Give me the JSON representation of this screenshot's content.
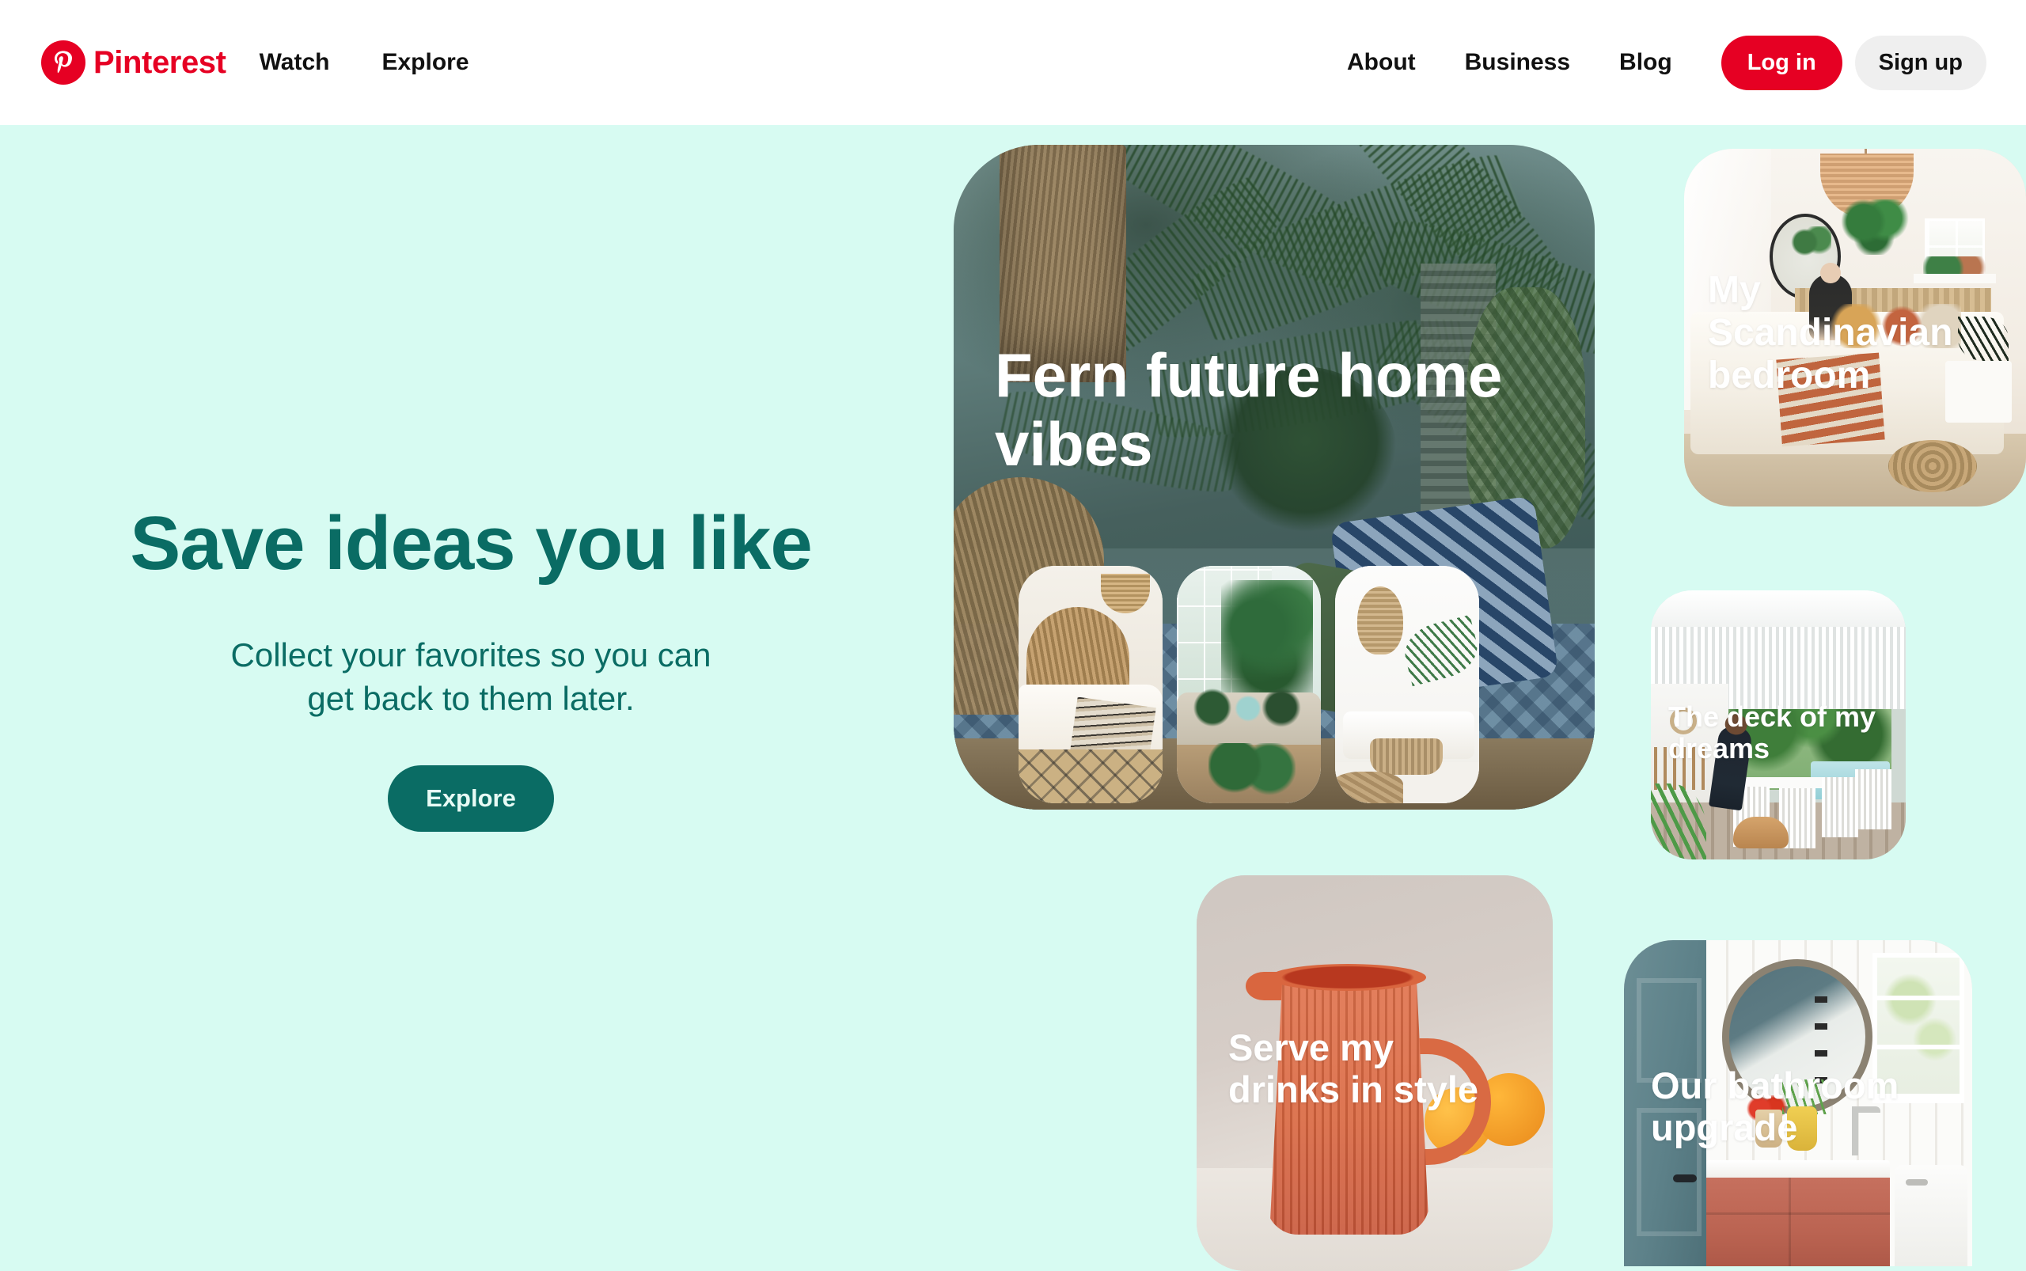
{
  "header": {
    "logo": {
      "icon": "pinterest-logo-icon",
      "wordmark": "Pinterest",
      "color": "#e60023"
    },
    "nav_left": [
      {
        "label": "Watch"
      },
      {
        "label": "Explore"
      }
    ],
    "nav_right": [
      {
        "label": "About"
      },
      {
        "label": "Business"
      },
      {
        "label": "Blog"
      }
    ],
    "login_label": "Log in",
    "signup_label": "Sign up"
  },
  "hero": {
    "title": "Save ideas you like",
    "subtitle_line1": "Collect your favorites so you can",
    "subtitle_line2": "get back to them later.",
    "cta_label": "Explore",
    "background_color": "#d7fbf2",
    "accent_color": "#0a6c64"
  },
  "cards": [
    {
      "id": "fern",
      "label": "Fern future home vibes",
      "scene": "tropical palm and fern wallpaper with rattan chair, ikat cushions and woven bench",
      "thumbnails": [
        {
          "scene": "boho bedroom with woven palm headboard, rattan pendant and patterned rug"
        },
        {
          "scene": "living room with large monstera plants, linen sofa and tropical curtains"
        },
        {
          "scene": "white living room with rattan pendant light and wicker coffee table"
        }
      ]
    },
    {
      "id": "scandi",
      "label": "My Scandinavian bedroom",
      "scene": "bright bedroom with rattan pendant lamp, round mirror, hanging plant, woman on bed and jute pouf"
    },
    {
      "id": "deck",
      "label": "The deck of my dreams",
      "scene": "white slatted pergola deck with woman setting table, dog, garden and pool"
    },
    {
      "id": "drinks",
      "label": "Serve my drinks in style",
      "scene": "terracotta ribbed ceramic pitcher with oranges on a light table"
    },
    {
      "id": "bath",
      "label": "Our bathroom upgrade",
      "scene": "shiplap bathroom with round mirror, terracotta vanity and teal door"
    }
  ]
}
